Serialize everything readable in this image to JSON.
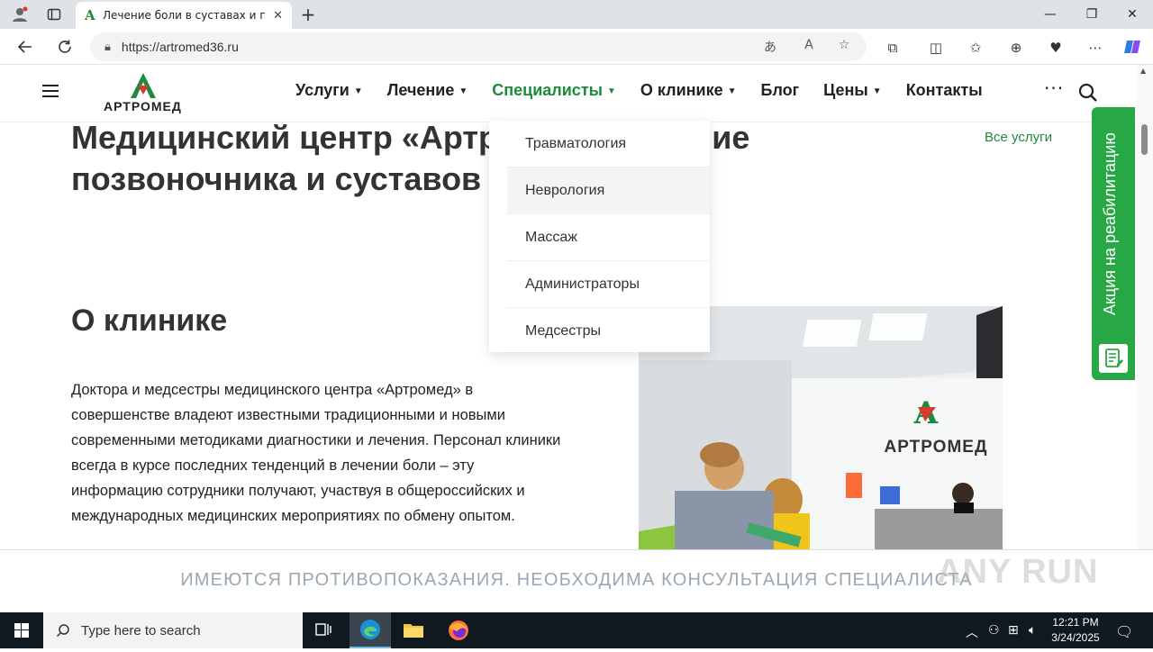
{
  "browser": {
    "tab_title": "Лечение боли в суставах и поз",
    "url": "https://artromed36.ru"
  },
  "site": {
    "logo_text": "АРТРОМЕД",
    "menu": [
      {
        "label": "Услуги",
        "has_caret": true
      },
      {
        "label": "Лечение",
        "has_caret": true
      },
      {
        "label": "Специалисты",
        "has_caret": true,
        "active": true
      },
      {
        "label": "О клинике",
        "has_caret": true
      },
      {
        "label": "Блог",
        "has_caret": false
      },
      {
        "label": "Цены",
        "has_caret": true
      },
      {
        "label": "Контакты",
        "has_caret": false
      }
    ],
    "more_label": "···",
    "accent_color": "#1d8a3c"
  },
  "dropdown": {
    "items": [
      "Травматология",
      "Неврология",
      "Массаж",
      "Администраторы",
      "Медсестры"
    ],
    "hovered": "Неврология"
  },
  "main": {
    "title": "Медицинский центр «Артромед»: лечение позвоночника и суставов",
    "all_services": "Все услуги",
    "about_heading": "О клинике",
    "about_text": "Доктора и медсестры медицинского центра «Артромед» в совершенстве владеют известными традиционными  и новыми современными методиками диагностики и лечения. Персонал клиники всегда в курсе последних тенденций в лечении боли – эту информацию сотрудники получают, участвуя в общероссийских и международных медицинских мероприятиях по обмену опытом.",
    "photo_sign": "АРТРОМЕД"
  },
  "promo": {
    "label": "Акция на реабилитацию",
    "color": "#27a844"
  },
  "disclaimer": "ИМЕЮТСЯ ПРОТИВОПОКАЗАНИЯ. НЕОБХОДИМА КОНСУЛЬТАЦИЯ СПЕЦИАЛИСТА",
  "watermark": "ANY RUN",
  "taskbar": {
    "search_placeholder": "Type here to search",
    "time": "12:21 PM",
    "date": "3/24/2025"
  }
}
